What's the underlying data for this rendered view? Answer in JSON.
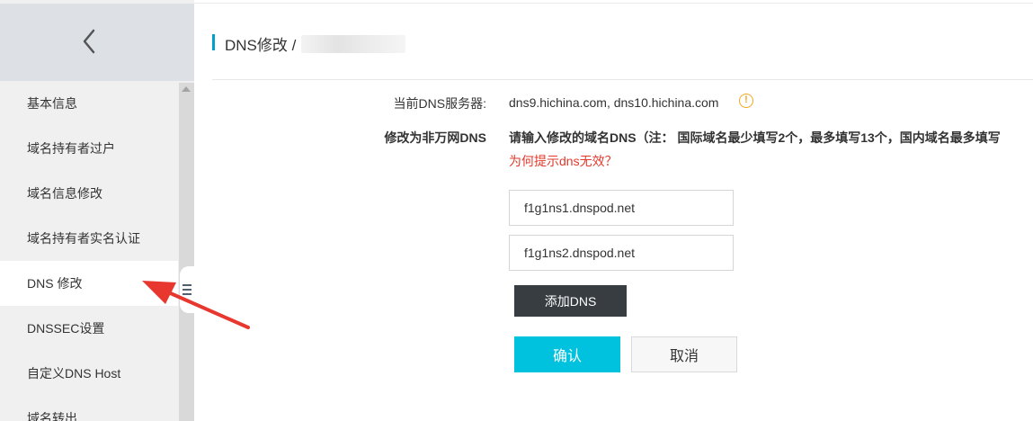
{
  "sidebar": {
    "back_icon": "chevron-left-icon",
    "items": [
      {
        "label": "基本信息"
      },
      {
        "label": "域名持有者过户"
      },
      {
        "label": "域名信息修改"
      },
      {
        "label": "域名持有者实名认证"
      },
      {
        "label": "DNS 修改"
      },
      {
        "label": "DNSSEC设置"
      },
      {
        "label": "自定义DNS Host"
      },
      {
        "label": "域名转出"
      }
    ],
    "active_index": 4
  },
  "header": {
    "breadcrumb": "DNS修改 /"
  },
  "form": {
    "current_label": "当前DNS服务器:",
    "current_value": "dns9.hichina.com, dns10.hichina.com",
    "modify_label": "修改为非万网DNS",
    "instruction": "请输入修改的域名DNS（注： 国际域名最少填写2个，最多填写13个，国内域名最多填写",
    "help_link": "为何提示dns无效？",
    "dns_inputs": [
      {
        "value": "f1g1ns1.dnspod.net"
      },
      {
        "value": "f1g1ns2.dnspod.net"
      }
    ],
    "add_button": "添加DNS",
    "confirm_button": "确认",
    "cancel_button": "取消"
  },
  "colors": {
    "accent": "#ff6a00",
    "primary_button": "#00c1de",
    "dark_button": "#373d41",
    "link_red": "#e23a2c",
    "warning": "#f5a623",
    "annotation_arrow": "#e8372e"
  }
}
